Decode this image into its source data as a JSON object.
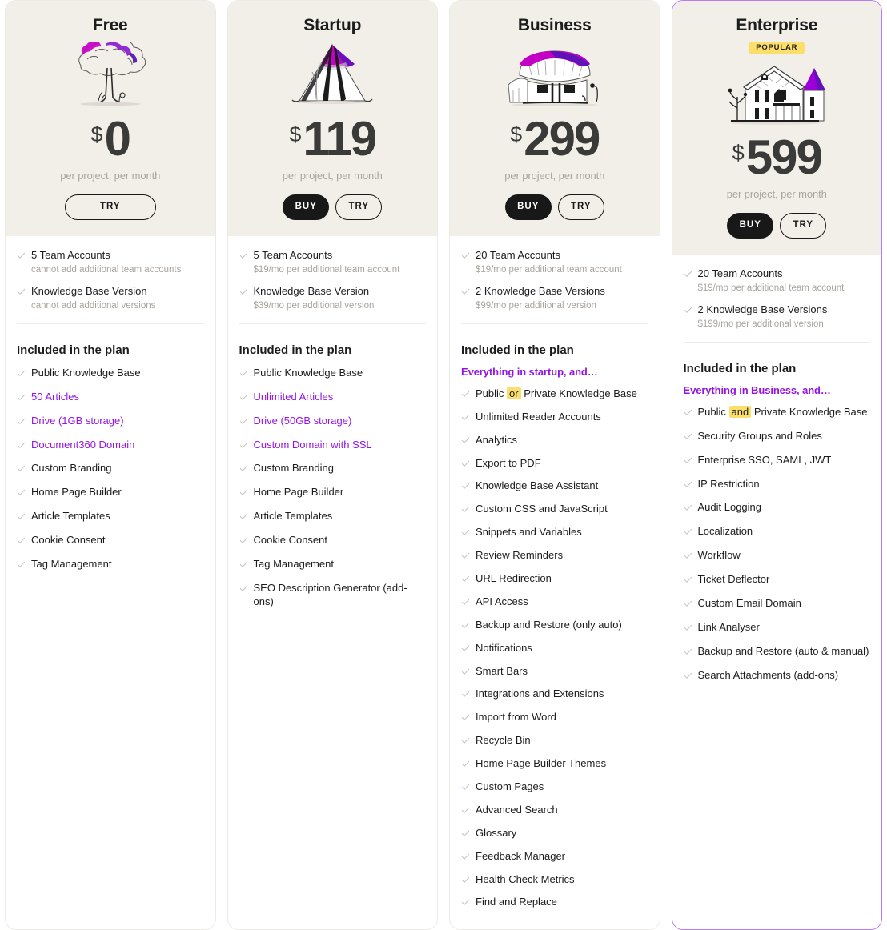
{
  "plans": [
    {
      "name": "Free",
      "badge": null,
      "illustration": "tree-illustration",
      "currency": "$",
      "amount": "0",
      "price_note": "per project, per month",
      "buttons": {
        "buy": null,
        "try": "TRY"
      },
      "limits": [
        {
          "title": "5 Team Accounts",
          "sub": "cannot add additional team accounts"
        },
        {
          "title": "Knowledge Base Version",
          "sub": "cannot add additional versions"
        }
      ],
      "included_title": "Included in the plan",
      "everything_line": null,
      "features": [
        {
          "text": "Public Knowledge Base",
          "purple": false
        },
        {
          "text": "50 Articles",
          "purple": true
        },
        {
          "text": "Drive (1GB storage)",
          "purple": true
        },
        {
          "text": "Document360 Domain",
          "purple": true
        },
        {
          "text": "Custom Branding",
          "purple": false
        },
        {
          "text": "Home Page Builder",
          "purple": false
        },
        {
          "text": "Article Templates",
          "purple": false
        },
        {
          "text": "Cookie Consent",
          "purple": false
        },
        {
          "text": "Tag Management",
          "purple": false
        }
      ]
    },
    {
      "name": "Startup",
      "badge": null,
      "illustration": "tent-illustration",
      "currency": "$",
      "amount": "119",
      "price_note": "per project, per month",
      "buttons": {
        "buy": "BUY",
        "try": "TRY"
      },
      "limits": [
        {
          "title": "5 Team Accounts",
          "sub": "$19/mo per additional team account"
        },
        {
          "title": "Knowledge Base Version",
          "sub": "$39/mo per additional version"
        }
      ],
      "included_title": "Included in the plan",
      "everything_line": null,
      "features": [
        {
          "text": "Public Knowledge Base",
          "purple": false
        },
        {
          "text": "Unlimited Articles",
          "purple": true
        },
        {
          "text": "Drive (50GB storage)",
          "purple": true
        },
        {
          "text": "Custom Domain with SSL",
          "purple": true
        },
        {
          "text": "Custom Branding",
          "purple": false
        },
        {
          "text": "Home Page Builder",
          "purple": false
        },
        {
          "text": "Article Templates",
          "purple": false
        },
        {
          "text": "Cookie Consent",
          "purple": false
        },
        {
          "text": "Tag Management",
          "purple": false
        },
        {
          "text": "SEO Description Generator (add-ons)",
          "purple": false
        }
      ]
    },
    {
      "name": "Business",
      "badge": null,
      "illustration": "hut-illustration",
      "currency": "$",
      "amount": "299",
      "price_note": "per project, per month",
      "buttons": {
        "buy": "BUY",
        "try": "TRY"
      },
      "limits": [
        {
          "title": "20 Team Accounts",
          "sub": "$19/mo per additional team account"
        },
        {
          "title": "2 Knowledge Base Versions",
          "sub": "$99/mo per additional version"
        }
      ],
      "included_title": "Included in the plan",
      "everything_line": "Everything in startup, and…",
      "features": [
        {
          "text": "Public or Private Knowledge Base",
          "purple": false,
          "highlight": "or"
        },
        {
          "text": "Unlimited Reader Accounts",
          "purple": false
        },
        {
          "text": "Analytics",
          "purple": false
        },
        {
          "text": "Export to PDF",
          "purple": false
        },
        {
          "text": "Knowledge Base Assistant",
          "purple": false
        },
        {
          "text": "Custom CSS and JavaScript",
          "purple": false
        },
        {
          "text": "Snippets and Variables",
          "purple": false
        },
        {
          "text": "Review Reminders",
          "purple": false
        },
        {
          "text": "URL Redirection",
          "purple": false
        },
        {
          "text": "API Access",
          "purple": false
        },
        {
          "text": "Backup and Restore (only auto)",
          "purple": false
        },
        {
          "text": "Notifications",
          "purple": false
        },
        {
          "text": "Smart Bars",
          "purple": false
        },
        {
          "text": "Integrations and Extensions",
          "purple": false
        },
        {
          "text": "Import from Word",
          "purple": false
        },
        {
          "text": "Recycle Bin",
          "purple": false
        },
        {
          "text": "Home Page Builder Themes",
          "purple": false
        },
        {
          "text": "Custom Pages",
          "purple": false
        },
        {
          "text": "Advanced Search",
          "purple": false
        },
        {
          "text": "Glossary",
          "purple": false
        },
        {
          "text": "Feedback Manager",
          "purple": false
        },
        {
          "text": "Health Check Metrics",
          "purple": false
        },
        {
          "text": "Find and Replace",
          "purple": false
        }
      ]
    },
    {
      "name": "Enterprise",
      "badge": "POPULAR",
      "illustration": "mansion-illustration",
      "currency": "$",
      "amount": "599",
      "price_note": "per project, per month",
      "buttons": {
        "buy": "BUY",
        "try": "TRY"
      },
      "limits": [
        {
          "title": "20 Team Accounts",
          "sub": "$19/mo per additional team account"
        },
        {
          "title": "2 Knowledge Base Versions",
          "sub": "$199/mo per additional version"
        }
      ],
      "included_title": "Included in the plan",
      "everything_line": "Everything in Business, and…",
      "features": [
        {
          "text": "Public and Private Knowledge Base",
          "purple": false,
          "highlight": "and"
        },
        {
          "text": "Security Groups and Roles",
          "purple": false
        },
        {
          "text": "Enterprise SSO, SAML, JWT",
          "purple": false
        },
        {
          "text": "IP Restriction",
          "purple": false
        },
        {
          "text": "Audit Logging",
          "purple": false
        },
        {
          "text": "Localization",
          "purple": false
        },
        {
          "text": "Workflow",
          "purple": false
        },
        {
          "text": "Ticket Deflector",
          "purple": false
        },
        {
          "text": "Custom Email Domain",
          "purple": false
        },
        {
          "text": "Link Analyser",
          "purple": false
        },
        {
          "text": "Backup and Restore (auto & manual)",
          "purple": false
        },
        {
          "text": "Search Attachments (add-ons)",
          "purple": false
        }
      ]
    }
  ],
  "colors": {
    "accent_purple": "#9414e0",
    "featured_border": "#b77cf2",
    "badge_yellow": "#fcdf6a",
    "header_bg": "#f2efe9",
    "price_text": "#3a3a38",
    "muted_text": "#a9a59d"
  }
}
